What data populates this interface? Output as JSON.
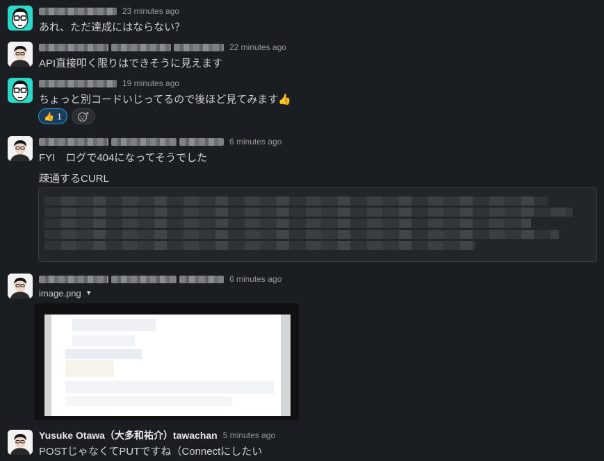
{
  "messages": [
    {
      "time": "23 minutes ago",
      "text": "あれ、ただ達成にはならない？",
      "avatar_icon": "glasses-avatar-icon"
    },
    {
      "time": "22 minutes ago",
      "text": "API直接叩く限りはできそうに見えます",
      "avatar_icon": "person-avatar-icon"
    },
    {
      "time": "19 minutes ago",
      "text": "ちょっと別コードいじってるので後ほど見てみます👍",
      "avatar_icon": "glasses-avatar-icon",
      "reactions": [
        {
          "emoji": "👍",
          "count": "1"
        }
      ],
      "add_reaction_icon": "add-reaction-icon"
    },
    {
      "time": "6 minutes ago",
      "text": "FYI　ログで404になってそうでした",
      "text2": "疎通するCURL",
      "avatar_icon": "person-avatar-icon"
    },
    {
      "time": "6 minutes ago",
      "file_name": "image.png",
      "avatar_icon": "person-avatar-icon"
    },
    {
      "author": "Yusuke Otawa（大多和祐介）tawachan",
      "time": "5 minutes ago",
      "text": "POSTじゃなくてPUTですね（Connectにしたい",
      "avatar_icon": "person-avatar-icon"
    }
  ],
  "colors": {
    "background": "#1a1d21",
    "text": "#d1d2d3",
    "timestamp": "#9a9b9d",
    "reaction_active_border": "#1d9bd1",
    "avatar_teal": "#2ad9c8"
  }
}
